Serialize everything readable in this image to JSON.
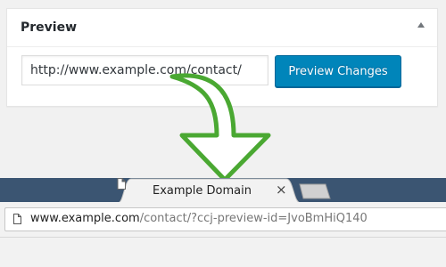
{
  "metabox": {
    "title": "Preview",
    "url_value": "http://www.example.com/contact/",
    "preview_button_label": "Preview Changes"
  },
  "browser": {
    "tab_title": "Example Domain",
    "tab_close_glyph": "×",
    "url_host": "www.example.com",
    "url_rest": "/contact/?ccj-preview-id=JvoBmHiQ140"
  },
  "icons": {
    "collapse": "triangle-up-icon",
    "tab_page": "document-icon",
    "omnibox_page": "document-icon",
    "arrow": "curved-down-arrow-icon"
  },
  "colors": {
    "button_bg": "#0085ba",
    "arrow_stroke": "#4aa832",
    "tabstrip": "#3b5572"
  }
}
